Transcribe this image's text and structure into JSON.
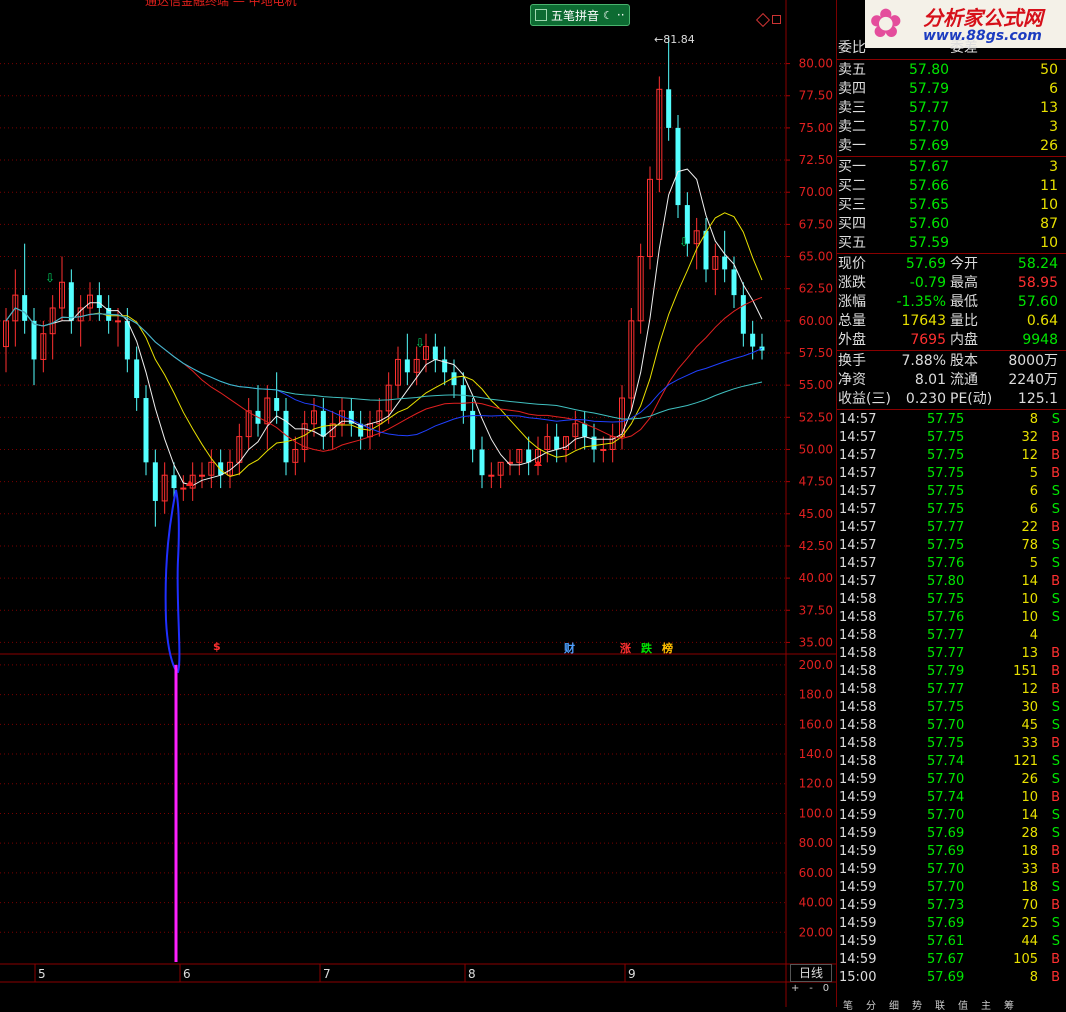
{
  "window": {
    "title_fragment": "通达信金融终端 — 中地电机"
  },
  "ime": {
    "label": "五笔拼音"
  },
  "chart_data": {
    "type": "candlestick",
    "price_axis": {
      "ticks": [
        "80.00",
        "77.50",
        "75.00",
        "72.50",
        "70.00",
        "67.50",
        "65.00",
        "62.50",
        "60.00",
        "57.50",
        "55.00",
        "52.50",
        "50.00",
        "47.50",
        "45.00",
        "42.50",
        "40.00",
        "37.50",
        "35.00"
      ],
      "range": [
        34.1,
        83.0
      ]
    },
    "volume_axis": {
      "ticks": [
        "200.0",
        "180.0",
        "160.0",
        "140.0",
        "120.0",
        "100.0",
        "80.00",
        "60.00",
        "40.00",
        "20.00"
      ],
      "range": [
        0,
        206
      ]
    },
    "date_labels": [
      "5",
      "6",
      "7",
      "8",
      "9"
    ],
    "max_label": "81.84",
    "volume_bar": 200,
    "event_markers": [
      "$",
      "财",
      "涨",
      "跌",
      "榜"
    ],
    "period": "日线",
    "zoom_controls": [
      "+",
      "-",
      "0"
    ],
    "candles": [
      [
        58,
        61,
        56,
        60
      ],
      [
        60,
        64,
        58,
        62
      ],
      [
        62,
        66,
        59,
        60
      ],
      [
        60,
        61,
        55,
        57
      ],
      [
        57,
        60,
        56,
        59
      ],
      [
        59,
        62,
        57,
        61
      ],
      [
        61,
        65,
        60,
        63
      ],
      [
        63,
        64,
        59,
        60
      ],
      [
        60,
        62,
        58,
        61
      ],
      [
        61,
        63,
        60,
        62
      ],
      [
        62,
        63,
        60,
        61
      ],
      [
        61,
        62,
        59,
        60
      ],
      [
        60,
        61,
        58,
        60
      ],
      [
        60,
        61,
        56,
        57
      ],
      [
        57,
        58,
        53,
        54
      ],
      [
        54,
        55,
        48,
        49
      ],
      [
        49,
        50,
        44,
        46
      ],
      [
        46,
        49,
        45,
        48
      ],
      [
        48,
        49,
        46,
        47
      ],
      [
        47,
        48,
        46,
        47
      ],
      [
        47,
        49,
        46,
        48
      ],
      [
        48,
        49,
        47,
        48
      ],
      [
        48,
        50,
        47,
        49
      ],
      [
        49,
        50,
        47,
        48
      ],
      [
        48,
        50,
        47,
        49
      ],
      [
        49,
        52,
        48,
        51
      ],
      [
        51,
        54,
        50,
        53
      ],
      [
        53,
        55,
        51,
        52
      ],
      [
        52,
        55,
        50,
        54
      ],
      [
        54,
        56,
        52,
        53
      ],
      [
        53,
        54,
        48,
        49
      ],
      [
        49,
        51,
        48,
        50
      ],
      [
        50,
        53,
        49,
        52
      ],
      [
        52,
        54,
        51,
        53
      ],
      [
        53,
        54,
        50,
        51
      ],
      [
        51,
        53,
        50,
        52
      ],
      [
        52,
        54,
        51,
        53
      ],
      [
        53,
        54,
        51,
        52
      ],
      [
        52,
        53,
        50,
        51
      ],
      [
        51,
        53,
        50,
        52
      ],
      [
        52,
        54,
        51,
        53
      ],
      [
        53,
        56,
        52,
        55
      ],
      [
        55,
        58,
        54,
        57
      ],
      [
        57,
        59,
        55,
        56
      ],
      [
        56,
        58,
        55,
        57
      ],
      [
        57,
        59,
        56,
        58
      ],
      [
        58,
        59,
        56,
        57
      ],
      [
        57,
        58,
        55,
        56
      ],
      [
        56,
        57,
        54,
        55
      ],
      [
        55,
        56,
        52,
        53
      ],
      [
        53,
        54,
        49,
        50
      ],
      [
        50,
        51,
        47,
        48
      ],
      [
        48,
        49,
        47,
        48
      ],
      [
        48,
        49,
        47,
        49
      ],
      [
        49,
        50,
        48,
        49
      ],
      [
        49,
        50,
        48,
        50
      ],
      [
        50,
        51,
        48,
        49
      ],
      [
        49,
        51,
        48,
        50
      ],
      [
        50,
        52,
        49,
        51
      ],
      [
        51,
        52,
        49,
        50
      ],
      [
        50,
        51,
        49,
        51
      ],
      [
        51,
        53,
        50,
        52
      ],
      [
        52,
        53,
        50,
        51
      ],
      [
        51,
        52,
        49,
        50
      ],
      [
        50,
        51,
        49,
        50
      ],
      [
        50,
        52,
        49,
        51
      ],
      [
        51,
        55,
        50,
        54
      ],
      [
        54,
        61,
        53,
        60
      ],
      [
        60,
        66,
        59,
        65
      ],
      [
        65,
        72,
        64,
        71
      ],
      [
        71,
        79,
        70,
        78
      ],
      [
        78,
        82,
        74,
        75
      ],
      [
        75,
        76,
        68,
        69
      ],
      [
        69,
        70,
        65,
        66
      ],
      [
        66,
        68,
        64,
        67
      ],
      [
        67,
        68,
        63,
        64
      ],
      [
        64,
        66,
        62,
        65
      ],
      [
        65,
        67,
        63,
        64
      ],
      [
        64,
        65,
        61,
        62
      ],
      [
        62,
        63,
        58,
        59
      ],
      [
        59,
        60,
        57,
        58
      ],
      [
        58,
        59,
        57,
        57.69
      ]
    ]
  },
  "panel": {
    "logo_brand": "分析家公式网",
    "logo_site": "www.88gs.com",
    "header": {
      "label": "委比",
      "label2": "委差"
    },
    "sells": [
      {
        "label": "卖五",
        "price": "57.80",
        "vol": "50"
      },
      {
        "label": "卖四",
        "price": "57.79",
        "vol": "6"
      },
      {
        "label": "卖三",
        "price": "57.77",
        "vol": "13"
      },
      {
        "label": "卖二",
        "price": "57.70",
        "vol": "3"
      },
      {
        "label": "卖一",
        "price": "57.69",
        "vol": "26"
      }
    ],
    "buys": [
      {
        "label": "买一",
        "price": "57.67",
        "vol": "3"
      },
      {
        "label": "买二",
        "price": "57.66",
        "vol": "11"
      },
      {
        "label": "买三",
        "price": "57.65",
        "vol": "10"
      },
      {
        "label": "买四",
        "price": "57.60",
        "vol": "87"
      },
      {
        "label": "买五",
        "price": "57.59",
        "vol": "10"
      }
    ],
    "stats": [
      {
        "l1": "现价",
        "v1": "57.69",
        "c1": "grn",
        "l2": "今开",
        "v2": "58.24",
        "c2": "grn"
      },
      {
        "l1": "涨跌",
        "v1": "-0.79",
        "c1": "grn",
        "l2": "最高",
        "v2": "58.95",
        "c2": "red"
      },
      {
        "l1": "涨幅",
        "v1": "-1.35%",
        "c1": "grn",
        "l2": "最低",
        "v2": "57.60",
        "c2": "grn"
      },
      {
        "l1": "总量",
        "v1": "17643",
        "c1": "yel",
        "l2": "量比",
        "v2": "0.64",
        "c2": "yel"
      },
      {
        "l1": "外盘",
        "v1": "7695",
        "c1": "red",
        "l2": "内盘",
        "v2": "9948",
        "c2": "grn"
      }
    ],
    "info": [
      {
        "l1": "换手",
        "v1": "7.88%",
        "l2": "股本",
        "v2": "8000万"
      },
      {
        "l1": "净资",
        "v1": "8.01",
        "l2": "流通",
        "v2": "2240万"
      },
      {
        "l1": "收益(三)",
        "v1": "0.230",
        "l2": "PE(动)",
        "v2": "125.1"
      }
    ],
    "ticks": [
      [
        "14:57",
        "57.75",
        "8",
        "S"
      ],
      [
        "14:57",
        "57.75",
        "32",
        "B"
      ],
      [
        "14:57",
        "57.75",
        "12",
        "B"
      ],
      [
        "14:57",
        "57.75",
        "5",
        "B"
      ],
      [
        "14:57",
        "57.75",
        "6",
        "S"
      ],
      [
        "14:57",
        "57.75",
        "6",
        "S"
      ],
      [
        "14:57",
        "57.77",
        "22",
        "B"
      ],
      [
        "14:57",
        "57.75",
        "78",
        "S"
      ],
      [
        "14:57",
        "57.76",
        "5",
        "S"
      ],
      [
        "14:57",
        "57.80",
        "14",
        "B"
      ],
      [
        "14:58",
        "57.75",
        "10",
        "S"
      ],
      [
        "14:58",
        "57.76",
        "10",
        "S"
      ],
      [
        "14:58",
        "57.77",
        "4",
        ""
      ],
      [
        "14:58",
        "57.77",
        "13",
        "B"
      ],
      [
        "14:58",
        "57.79",
        "151",
        "B"
      ],
      [
        "14:58",
        "57.77",
        "12",
        "B"
      ],
      [
        "14:58",
        "57.75",
        "30",
        "S"
      ],
      [
        "14:58",
        "57.70",
        "45",
        "S"
      ],
      [
        "14:58",
        "57.75",
        "33",
        "B"
      ],
      [
        "14:58",
        "57.74",
        "121",
        "S"
      ],
      [
        "14:59",
        "57.70",
        "26",
        "S"
      ],
      [
        "14:59",
        "57.74",
        "10",
        "B"
      ],
      [
        "14:59",
        "57.70",
        "14",
        "S"
      ],
      [
        "14:59",
        "57.69",
        "28",
        "S"
      ],
      [
        "14:59",
        "57.69",
        "18",
        "B"
      ],
      [
        "14:59",
        "57.70",
        "33",
        "B"
      ],
      [
        "14:59",
        "57.70",
        "18",
        "S"
      ],
      [
        "14:59",
        "57.73",
        "70",
        "B"
      ],
      [
        "14:59",
        "57.69",
        "25",
        "S"
      ],
      [
        "14:59",
        "57.61",
        "44",
        "S"
      ],
      [
        "14:59",
        "57.67",
        "105",
        "B"
      ],
      [
        "15:00",
        "57.69",
        "8",
        "B"
      ]
    ],
    "bottom_tabs": [
      "笔",
      "分",
      "细",
      "势",
      "联",
      "值",
      "主",
      "筹"
    ]
  }
}
